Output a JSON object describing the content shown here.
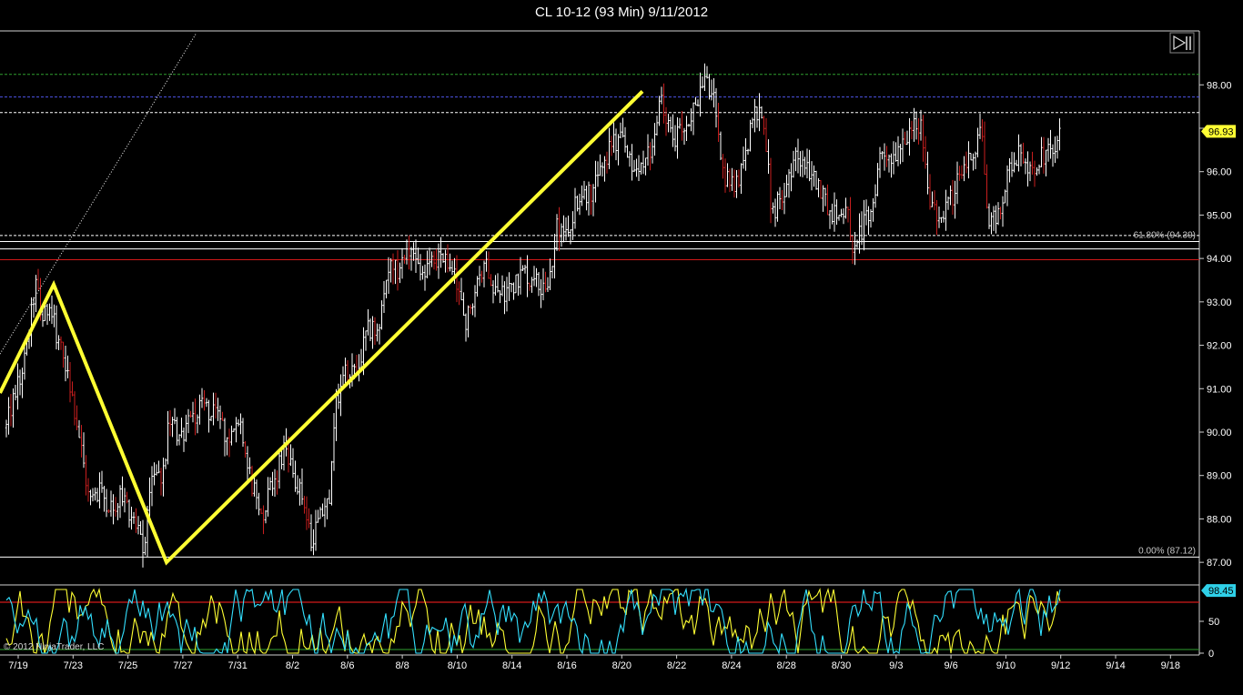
{
  "window": {
    "title": "CL 10-12 (93 Min)  9/11/2012"
  },
  "footer": {
    "copyright": "© 2012 NinjaTrader, LLC"
  },
  "colors": {
    "background": "#000000",
    "bar": "#ffffff",
    "down_bar_hint": "#c81e1e",
    "trendline": "#ffff33",
    "green_level": "#2fa02f",
    "blue_level": "#4d55e8",
    "red_level": "#d21919",
    "white_level": "#ffffff",
    "stoch_k": "#ffff33",
    "stoch_d": "#33e0ff",
    "price_marker_bg": "#ffff33",
    "osc_marker_bg": "#2fd0e8"
  },
  "icons": {
    "nav_button": "skip-to-end-icon"
  },
  "chart_data": [
    {
      "type": "candlestick",
      "title": "CL 10-12 (93 Min)  9/11/2012",
      "x_tick_labels": [
        "7/19",
        "7/23",
        "7/25",
        "7/27",
        "7/31",
        "8/2",
        "8/6",
        "8/8",
        "8/10",
        "8/14",
        "8/16",
        "8/20",
        "8/22",
        "8/24",
        "8/28",
        "8/30",
        "9/3",
        "9/6",
        "9/10",
        "9/12",
        "9/14",
        "9/18"
      ],
      "ylim": [
        86.5,
        99.2
      ],
      "y_ticks": [
        87.0,
        88.0,
        89.0,
        90.0,
        91.0,
        92.0,
        93.0,
        94.0,
        95.0,
        96.0,
        97.0,
        98.0
      ],
      "y_tick_labels": [
        "87.00",
        "88.00",
        "89.00",
        "90.00",
        "91.00",
        "92.00",
        "93.00",
        "94.00",
        "95.00",
        "96.00",
        "97.00",
        "98.00"
      ],
      "last_price": "96.93",
      "last_value": 96.93,
      "price_path": [
        {
          "x": 7.0,
          "y": 90.1
        },
        {
          "x": 16.0,
          "y": 90.9
        },
        {
          "x": 28.0,
          "y": 91.7
        },
        {
          "x": 39.0,
          "y": 93.4
        },
        {
          "x": 48.0,
          "y": 92.6
        },
        {
          "x": 55.0,
          "y": 93.0
        },
        {
          "x": 65.0,
          "y": 92.0
        },
        {
          "x": 78.0,
          "y": 91.0
        },
        {
          "x": 88.0,
          "y": 89.8
        },
        {
          "x": 98.0,
          "y": 88.4
        },
        {
          "x": 110.0,
          "y": 88.6
        },
        {
          "x": 122.0,
          "y": 88.3
        },
        {
          "x": 135.0,
          "y": 88.5
        },
        {
          "x": 147.0,
          "y": 88.0
        },
        {
          "x": 158.0,
          "y": 87.2
        },
        {
          "x": 168.0,
          "y": 89.2
        },
        {
          "x": 178.0,
          "y": 88.7
        },
        {
          "x": 186.0,
          "y": 90.3
        },
        {
          "x": 198.0,
          "y": 89.9
        },
        {
          "x": 212.0,
          "y": 90.4
        },
        {
          "x": 226.0,
          "y": 90.6
        },
        {
          "x": 238.0,
          "y": 90.3
        },
        {
          "x": 252.0,
          "y": 89.8
        },
        {
          "x": 265.0,
          "y": 90.2
        },
        {
          "x": 276.0,
          "y": 88.9
        },
        {
          "x": 288.0,
          "y": 88.1
        },
        {
          "x": 300.0,
          "y": 88.8
        },
        {
          "x": 312.0,
          "y": 89.6
        },
        {
          "x": 322.0,
          "y": 89.0
        },
        {
          "x": 332.0,
          "y": 88.6
        },
        {
          "x": 341.0,
          "y": 87.5
        },
        {
          "x": 352.0,
          "y": 88.0
        },
        {
          "x": 362.0,
          "y": 88.6
        },
        {
          "x": 368.0,
          "y": 90.5
        },
        {
          "x": 378.0,
          "y": 91.5
        },
        {
          "x": 392.0,
          "y": 91.3
        },
        {
          "x": 403.0,
          "y": 92.3
        },
        {
          "x": 416.0,
          "y": 92.4
        },
        {
          "x": 428.0,
          "y": 93.8
        },
        {
          "x": 440.0,
          "y": 93.7
        },
        {
          "x": 452.0,
          "y": 94.2
        },
        {
          "x": 462.0,
          "y": 93.6
        },
        {
          "x": 474.0,
          "y": 93.9
        },
        {
          "x": 486.0,
          "y": 94.1
        },
        {
          "x": 500.0,
          "y": 93.5
        },
        {
          "x": 512.0,
          "y": 92.5
        },
        {
          "x": 524.0,
          "y": 93.5
        },
        {
          "x": 536.0,
          "y": 93.8
        },
        {
          "x": 548.0,
          "y": 93.1
        },
        {
          "x": 562.0,
          "y": 93.4
        },
        {
          "x": 576.0,
          "y": 93.7
        },
        {
          "x": 590.0,
          "y": 93.4
        },
        {
          "x": 603.0,
          "y": 93.4
        },
        {
          "x": 612.0,
          "y": 94.7
        },
        {
          "x": 624.0,
          "y": 94.6
        },
        {
          "x": 636.0,
          "y": 95.5
        },
        {
          "x": 648.0,
          "y": 95.5
        },
        {
          "x": 660.0,
          "y": 96.0
        },
        {
          "x": 672.0,
          "y": 96.6
        },
        {
          "x": 684.0,
          "y": 96.7
        },
        {
          "x": 696.0,
          "y": 95.9
        },
        {
          "x": 708.0,
          "y": 96.2
        },
        {
          "x": 718.0,
          "y": 96.6
        },
        {
          "x": 726.0,
          "y": 97.6
        },
        {
          "x": 738.0,
          "y": 96.8
        },
        {
          "x": 750.0,
          "y": 96.9
        },
        {
          "x": 762.0,
          "y": 97.4
        },
        {
          "x": 774.0,
          "y": 98.2
        },
        {
          "x": 786.0,
          "y": 97.5
        },
        {
          "x": 794.0,
          "y": 96.0
        },
        {
          "x": 806.0,
          "y": 95.6
        },
        {
          "x": 818.0,
          "y": 96.1
        },
        {
          "x": 828.0,
          "y": 97.3
        },
        {
          "x": 840.0,
          "y": 97.2
        },
        {
          "x": 848.0,
          "y": 95.0
        },
        {
          "x": 860.0,
          "y": 95.5
        },
        {
          "x": 872.0,
          "y": 96.3
        },
        {
          "x": 884.0,
          "y": 96.1
        },
        {
          "x": 896.0,
          "y": 95.8
        },
        {
          "x": 908.0,
          "y": 95.3
        },
        {
          "x": 920.0,
          "y": 94.9
        },
        {
          "x": 930.0,
          "y": 95.2
        },
        {
          "x": 938.0,
          "y": 94.2
        },
        {
          "x": 948.0,
          "y": 94.7
        },
        {
          "x": 958.0,
          "y": 95.1
        },
        {
          "x": 968.0,
          "y": 96.5
        },
        {
          "x": 980.0,
          "y": 96.4
        },
        {
          "x": 992.0,
          "y": 96.6
        },
        {
          "x": 1002.0,
          "y": 97.0
        },
        {
          "x": 1012.0,
          "y": 97.1
        },
        {
          "x": 1020.0,
          "y": 95.4
        },
        {
          "x": 1032.0,
          "y": 95.0
        },
        {
          "x": 1044.0,
          "y": 95.3
        },
        {
          "x": 1052.0,
          "y": 95.7
        },
        {
          "x": 1062.0,
          "y": 96.2
        },
        {
          "x": 1072.0,
          "y": 96.5
        },
        {
          "x": 1078.0,
          "y": 97.2
        },
        {
          "x": 1086.0,
          "y": 94.8
        },
        {
          "x": 1096.0,
          "y": 94.9
        },
        {
          "x": 1104.0,
          "y": 95.6
        },
        {
          "x": 1112.0,
          "y": 96.2
        },
        {
          "x": 1122.0,
          "y": 96.5
        },
        {
          "x": 1132.0,
          "y": 96.1
        },
        {
          "x": 1142.0,
          "y": 96.3
        },
        {
          "x": 1154.0,
          "y": 96.4
        },
        {
          "x": 1166.0,
          "y": 96.9
        }
      ],
      "horizontal_levels": [
        {
          "value": 98.24,
          "color": "#2fa02f",
          "style": "dashed"
        },
        {
          "value": 97.72,
          "color": "#4d55e8",
          "style": "dashed"
        },
        {
          "value": 97.36,
          "color": "#ffffff",
          "style": "dashed"
        },
        {
          "value": 94.53,
          "color": "#ffffff",
          "style": "dashed"
        },
        {
          "value": 94.39,
          "color": "#ffffff",
          "style": "solid",
          "label": "61.80% (94.39)"
        },
        {
          "value": 94.22,
          "color": "#ffffff",
          "style": "solid"
        },
        {
          "value": 93.97,
          "color": "#d21919",
          "style": "solid"
        },
        {
          "value": 87.12,
          "color": "#ffffff",
          "style": "solid",
          "label": "0.00% (87.12)"
        }
      ],
      "drawn_trend_lines": [
        {
          "points": [
            {
              "x": 0.0,
              "y": 90.9
            },
            {
              "x": 59.0,
              "y": 93.4
            },
            {
              "x": 183.0,
              "y": 87.0
            },
            {
              "x": 706.0,
              "y": 97.85
            }
          ],
          "color": "#ffff33"
        },
        {
          "points": [
            {
              "x": 0.0,
              "y": 91.8
            },
            {
              "x": 216.0,
              "y": 99.2
            }
          ],
          "color": "#ffffff",
          "style": "dotted"
        }
      ],
      "grid": false
    },
    {
      "type": "line",
      "name": "stochastics-panel",
      "ylim": [
        0,
        100
      ],
      "y_ticks": [
        0,
        50
      ],
      "y_tick_labels": [
        "0",
        "50"
      ],
      "last_value": "98.45",
      "last_value_num": 98.45,
      "upper_level": 80,
      "lower_level": 20,
      "series": [
        {
          "color": "#ffff33",
          "seed": 7
        },
        {
          "color": "#33e0ff",
          "seed": 13
        }
      ]
    }
  ]
}
